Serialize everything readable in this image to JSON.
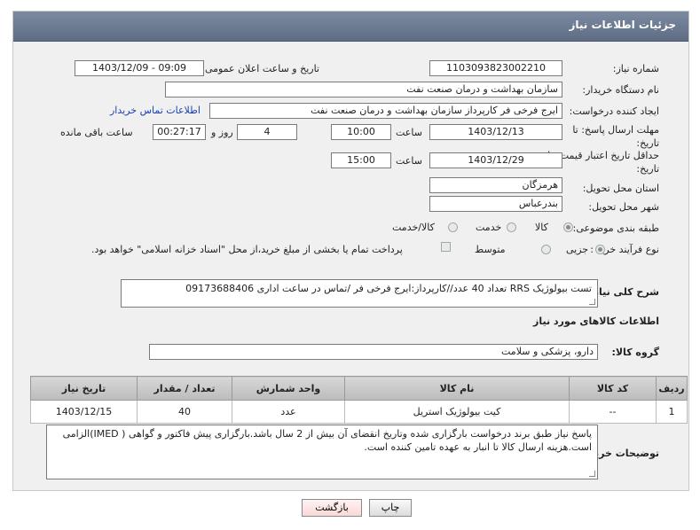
{
  "header": {
    "title": "جزئیات اطلاعات نیاز"
  },
  "form": {
    "need_number": {
      "label": "شماره نیاز:",
      "value": "1103093823002210"
    },
    "announce_datetime": {
      "label": "تاریخ و ساعت اعلان عمومی:",
      "value": "1403/12/09 - 09:09"
    },
    "buyer_org": {
      "label": "نام دستگاه خریدار:",
      "value": "سازمان بهداشت و درمان صنعت نفت"
    },
    "requester": {
      "label": "ایجاد کننده درخواست:",
      "value": "ایرج فرخی فر کارپرداز  سازمان بهداشت و درمان صنعت نفت",
      "contact_link": "اطلاعات تماس خریدار"
    },
    "reply_deadline": {
      "label": "مهلت ارسال پاسخ: تا تاریخ:",
      "date": "1403/12/13",
      "time_label": "ساعت",
      "time": "10:00",
      "days": "4",
      "days_label": "روز و",
      "remaining": "00:27:17",
      "remaining_label": "ساعت باقی مانده"
    },
    "price_validity": {
      "label": "حداقل تاریخ اعتبار قیمت: تا تاریخ:",
      "date": "1403/12/29",
      "time_label": "ساعت",
      "time": "15:00"
    },
    "province": {
      "label": "استان محل تحویل:",
      "value": "هرمزگان"
    },
    "city": {
      "label": "شهر محل تحویل:",
      "value": "بندرعباس"
    },
    "category": {
      "label": "طبقه بندی موضوعی:",
      "options": [
        "کالا",
        "خدمت",
        "کالا/خدمت"
      ],
      "selected": 0
    },
    "process": {
      "label": "نوع فرآیند خرید :",
      "options": [
        "جزیی",
        "متوسط"
      ],
      "selected": 0,
      "payment_note": "پرداخت تمام یا بخشی از مبلغ خرید،از محل \"اسناد خزانه اسلامی\" خواهد بود."
    }
  },
  "description": {
    "label": "شرح کلی نیاز:",
    "value": "تست بیولوژیک RRS  تعداد 40 عدد//کارپرداز:ایرج فرخی فر /تماس در ساعت اداری 09173688406"
  },
  "goods_section": {
    "title": "اطلاعات کالاهای مورد نیاز",
    "group_label": "گروه کالا:",
    "group_value": "دارو، پزشکی و سلامت"
  },
  "table": {
    "headers": [
      "ردیف",
      "کد کالا",
      "نام کالا",
      "واحد شمارش",
      "تعداد / مقدار",
      "تاریخ نیاز"
    ],
    "rows": [
      [
        "1",
        "--",
        "کیت بیولوژیک استریل",
        "عدد",
        "40",
        "1403/12/15"
      ]
    ]
  },
  "buyer_notes": {
    "label": "توضیحات خریدار:",
    "value": "پاسخ نیاز طبق برند درخواست بارگزاری شده وتاریخ انقضای آن بیش از 2 سال باشد.بارگزاری پیش فاکتور و گواهی ( IMED)الزامی است.هزینه ارسال کالا تا انبار به عهده تامین کننده است."
  },
  "buttons": {
    "print": "چاپ",
    "back": "بازگشت"
  },
  "colors": {
    "header_bg": "#6b7a91",
    "link": "#1a3fb0",
    "back_button_bg": "#fde4e4"
  }
}
